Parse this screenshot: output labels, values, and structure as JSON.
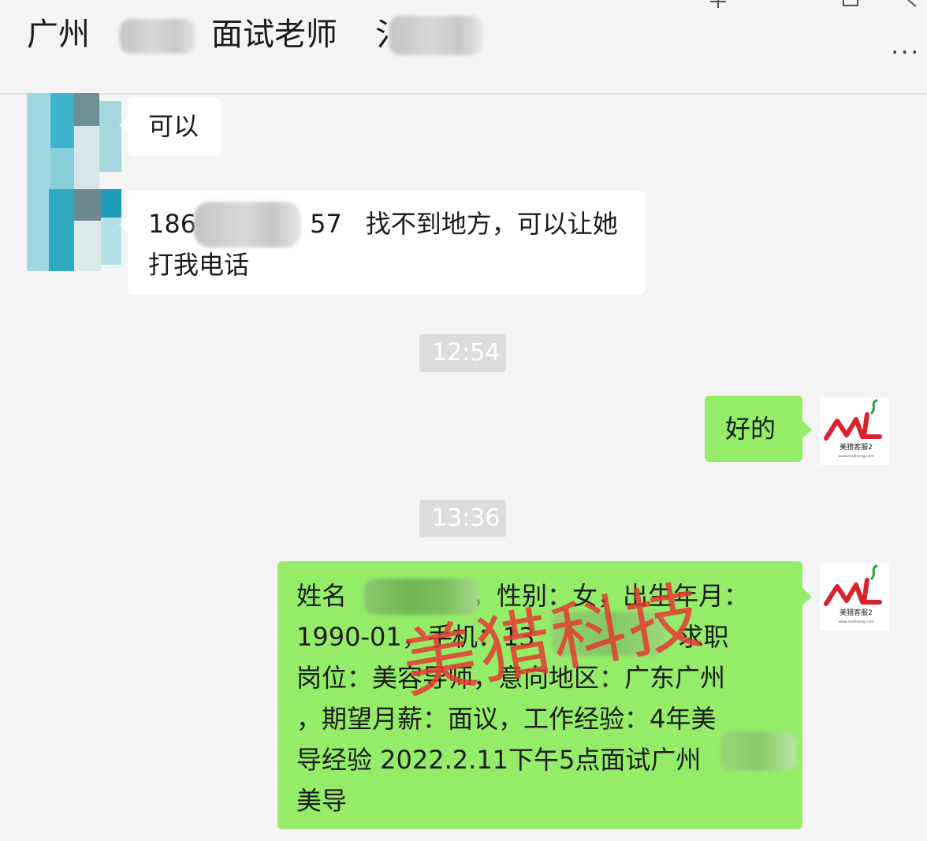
{
  "header": {
    "title_prefix": "广州",
    "title_middle": "面试老师",
    "title_suffix": "氵",
    "more_label": "..."
  },
  "messages": [
    {
      "sender": "contact",
      "text": "可以"
    },
    {
      "sender": "contact",
      "phone_start": "186",
      "phone_end": "57",
      "text_line1": "找不到地方，可以让她",
      "text_line2": "打我电话"
    },
    {
      "sender": "self",
      "text": "好的"
    },
    {
      "sender": "self",
      "lines": [
        {
          "a": "姓名",
          "b": "，性别：女，出生年月："
        },
        {
          "a": "1990-01，手机：13",
          "b": "，求职"
        },
        {
          "a": "岗位：美容导师，意向地区：广东广州"
        },
        {
          "a": "，期望月薪：面议，工作经验：4年美"
        },
        {
          "a": "导经验 2022.2.11下午5点面试广州"
        },
        {
          "a": "美导"
        }
      ]
    }
  ],
  "timestamps": [
    "12:54",
    "13:36"
  ],
  "self_avatar": {
    "logo_text": "ML",
    "caption": "美猎客服2",
    "url": "www.meilieeng.com"
  },
  "watermark": "美猎科技",
  "colors": {
    "background": "#f4f4f4",
    "bubble_in": "#ffffff",
    "bubble_out": "#95ec69",
    "timestamp_bg": "#dcdcdc",
    "watermark": "#e53b32",
    "logo_red": "#d9232d",
    "logo_green": "#2c9a3c"
  }
}
